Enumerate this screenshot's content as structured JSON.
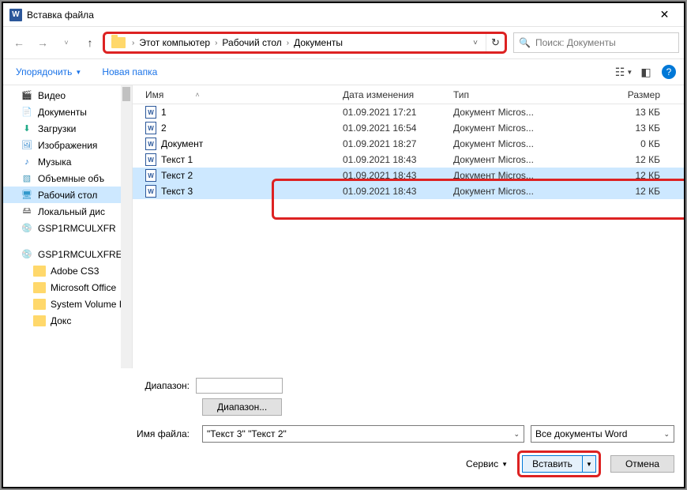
{
  "titlebar": {
    "title": "Вставка файла"
  },
  "breadcrumb": {
    "p1": "Этот компьютер",
    "p2": "Рабочий стол",
    "p3": "Документы"
  },
  "search": {
    "placeholder": "Поиск: Документы"
  },
  "toolbar": {
    "organize": "Упорядочить",
    "newfolder": "Новая папка"
  },
  "sidebar": [
    {
      "label": "Видео",
      "icon": "video"
    },
    {
      "label": "Документы",
      "icon": "doc"
    },
    {
      "label": "Загрузки",
      "icon": "download"
    },
    {
      "label": "Изображения",
      "icon": "image"
    },
    {
      "label": "Музыка",
      "icon": "music"
    },
    {
      "label": "Объемные объ",
      "icon": "3d"
    },
    {
      "label": "Рабочий стол",
      "icon": "desktop",
      "selected": true
    },
    {
      "label": "Локальный дис",
      "icon": "drive"
    },
    {
      "label": "GSP1RMCULXFR",
      "icon": "disc"
    },
    {
      "label": "",
      "spacer": true
    },
    {
      "label": "GSP1RMCULXFRE",
      "icon": "disc",
      "indent": false
    },
    {
      "label": "Adobe CS3",
      "icon": "folder",
      "indent": true
    },
    {
      "label": "Microsoft Office",
      "icon": "folder",
      "indent": true
    },
    {
      "label": "System Volume I",
      "icon": "folder",
      "indent": true
    },
    {
      "label": "Докс",
      "icon": "folder",
      "indent": true
    }
  ],
  "columns": {
    "name": "Имя",
    "date": "Дата изменения",
    "type": "Тип",
    "size": "Размер"
  },
  "files": [
    {
      "name": "1",
      "date": "01.09.2021 17:21",
      "type": "Документ Micros...",
      "size": "13 КБ"
    },
    {
      "name": "2",
      "date": "01.09.2021 16:54",
      "type": "Документ Micros...",
      "size": "13 КБ"
    },
    {
      "name": "Документ",
      "date": "01.09.2021 18:27",
      "type": "Документ Micros...",
      "size": "0 КБ"
    },
    {
      "name": "Текст 1",
      "date": "01.09.2021 18:43",
      "type": "Документ Micros...",
      "size": "12 КБ"
    },
    {
      "name": "Текст 2",
      "date": "01.09.2021 18:43",
      "type": "Документ Micros...",
      "size": "12 КБ",
      "selected": true
    },
    {
      "name": "Текст 3",
      "date": "01.09.2021 18:43",
      "type": "Документ Micros...",
      "size": "12 КБ",
      "selected": true
    }
  ],
  "range": {
    "label": "Диапазон:",
    "button": "Диапазон..."
  },
  "filename": {
    "label": "Имя файла:",
    "value": "\"Текст 3\" \"Текст 2\""
  },
  "filetype": {
    "value": "Все документы Word"
  },
  "actions": {
    "service": "Сервис",
    "insert": "Вставить",
    "cancel": "Отмена"
  }
}
